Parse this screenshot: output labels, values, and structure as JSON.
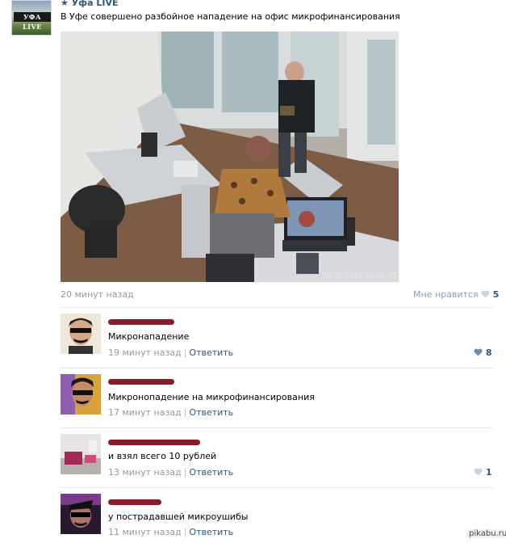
{
  "post": {
    "group_name": "★ Уфа LIVE",
    "avatar_logo": "УФА LIVE",
    "text": "В Уфе совершено разбойное нападение на офис микрофинансирования",
    "photo_timestamp": "28.12.2013 16:26:15",
    "time": "20 минут назад",
    "like_label": "Мне нравится",
    "like_count": "5"
  },
  "comments": [
    {
      "text": "Микронападение",
      "time": "19 минут назад",
      "reply_label": "Ответить",
      "likes": "8"
    },
    {
      "text": "Микронопадение на микрофинансирования",
      "time": "17 минут назад",
      "reply_label": "Ответить",
      "likes": ""
    },
    {
      "text": "и взял всего 10 рублей",
      "time": "13 минут назад",
      "reply_label": "Ответить",
      "likes": "1"
    },
    {
      "text": "у пострадавшей микроушибы",
      "time": "11 минут назад",
      "reply_label": "Ответить",
      "likes": ""
    }
  ],
  "watermark": "pikabu.ru",
  "colors": {
    "link": "#2b587a",
    "muted": "#999999",
    "redaction": "#8b1b2a",
    "heart": "#a4b6c9"
  },
  "icons": {
    "like": "heart-icon"
  }
}
